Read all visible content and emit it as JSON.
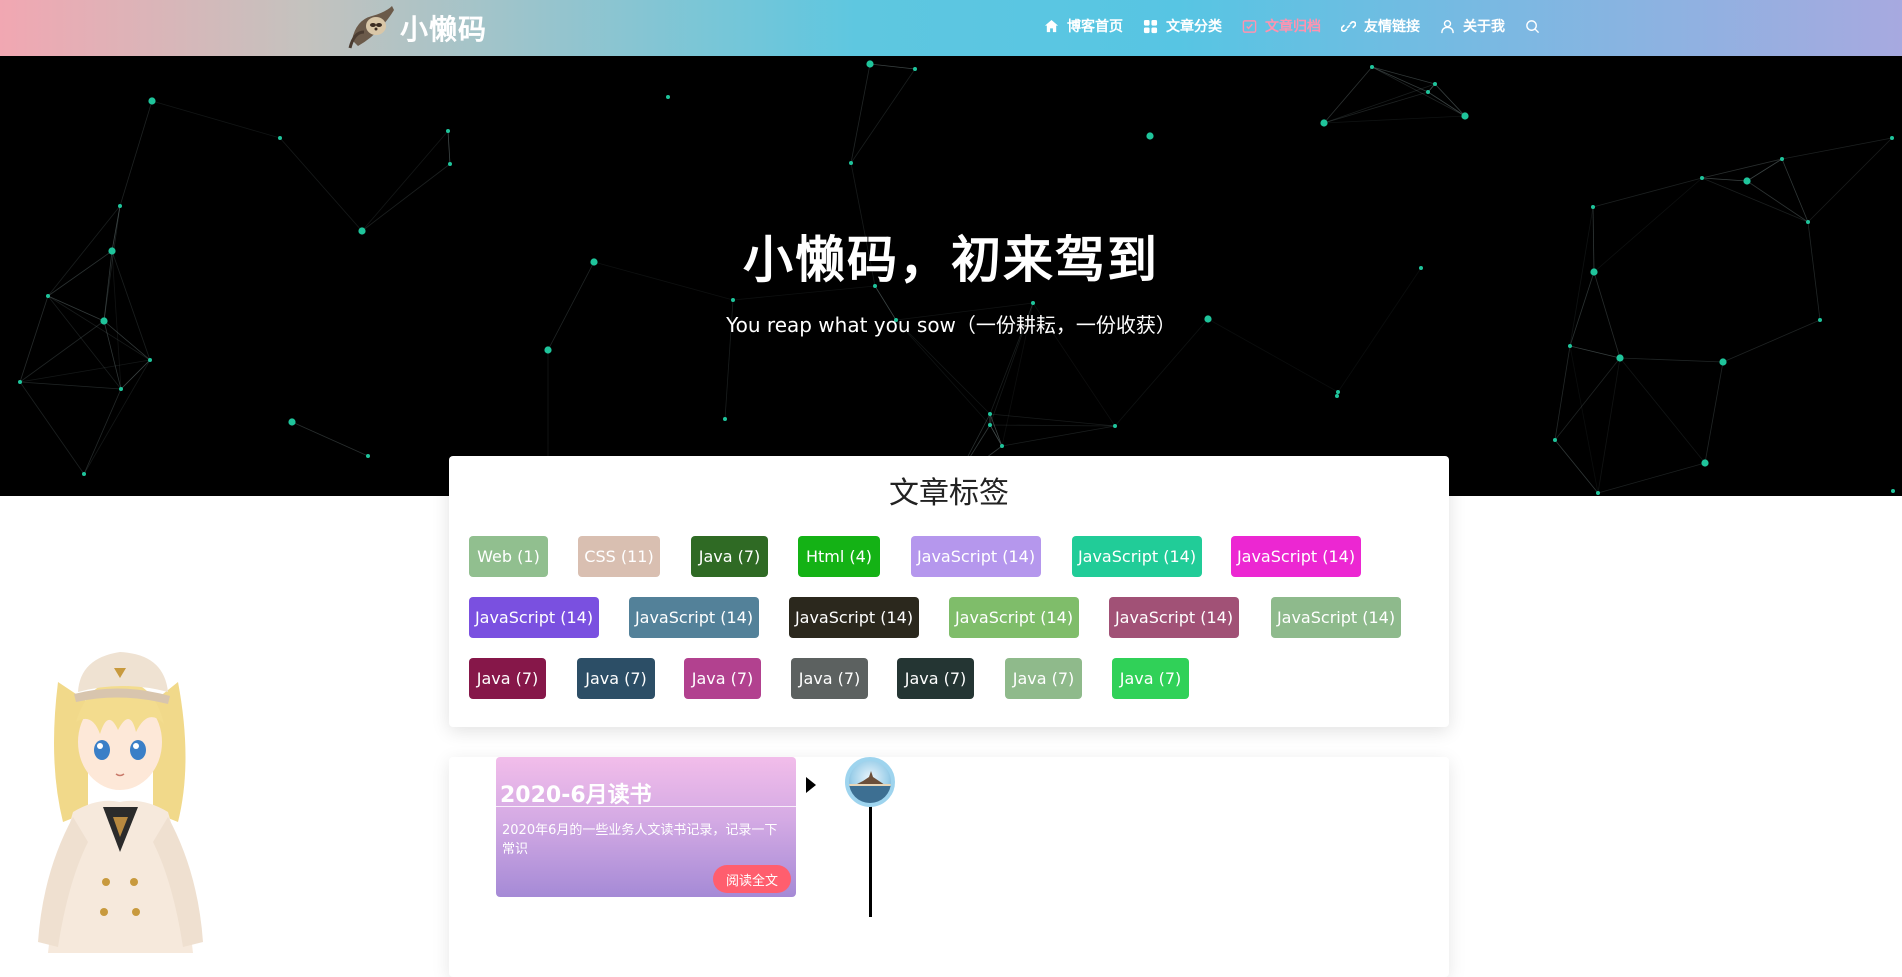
{
  "brand": {
    "name": "小懒码",
    "logo_icon": "sloth-logo-icon"
  },
  "nav": {
    "items": [
      {
        "label": "博客首页",
        "icon": "home-icon",
        "active": false
      },
      {
        "label": "文章分类",
        "icon": "grid-icon",
        "active": false
      },
      {
        "label": "文章归档",
        "icon": "archive-icon",
        "active": true
      },
      {
        "label": "友情链接",
        "icon": "link-icon",
        "active": false
      },
      {
        "label": "关于我",
        "icon": "user-icon",
        "active": false
      }
    ],
    "search_icon": "search-icon"
  },
  "hero": {
    "title": "小懒码，初来驾到",
    "subtitle": "You reap what you sow（一份耕耘，一份收获）"
  },
  "tags_section": {
    "title": "文章标签",
    "tags": [
      {
        "label": "Web (1)",
        "color": "#91bf8f"
      },
      {
        "label": "CSS (11)",
        "color": "#d9bfb1"
      },
      {
        "label": "Java (7)",
        "color": "#2f6a24"
      },
      {
        "label": "Html (4)",
        "color": "#14b215"
      },
      {
        "label": "JavaScript (14)",
        "color": "#b597ed"
      },
      {
        "label": "JavaScript (14)",
        "color": "#21cc98"
      },
      {
        "label": "JavaScript (14)",
        "color": "#ec27d2"
      },
      {
        "label": "JavaScript (14)",
        "color": "#7a50e0"
      },
      {
        "label": "JavaScript (14)",
        "color": "#538199"
      },
      {
        "label": "JavaScript (14)",
        "color": "#2b281d"
      },
      {
        "label": "JavaScript (14)",
        "color": "#7fbd6a"
      },
      {
        "label": "JavaScript (14)",
        "color": "#a15176"
      },
      {
        "label": "JavaScript (14)",
        "color": "#8eba8c"
      },
      {
        "label": "Java (7)",
        "color": "#861749"
      },
      {
        "label": "Java (7)",
        "color": "#2c4e66"
      },
      {
        "label": "Java (7)",
        "color": "#b2418f"
      },
      {
        "label": "Java (7)",
        "color": "#5c6160"
      },
      {
        "label": "Java (7)",
        "color": "#243533"
      },
      {
        "label": "Java (7)",
        "color": "#8fba8b"
      },
      {
        "label": "Java (7)",
        "color": "#30d158"
      }
    ]
  },
  "archive": {
    "posts": [
      {
        "title": "2020-6月读书",
        "description": "2020年6月的一些业务人文读书记录，记录一下常识",
        "read_more_label": "阅读全文"
      }
    ]
  }
}
